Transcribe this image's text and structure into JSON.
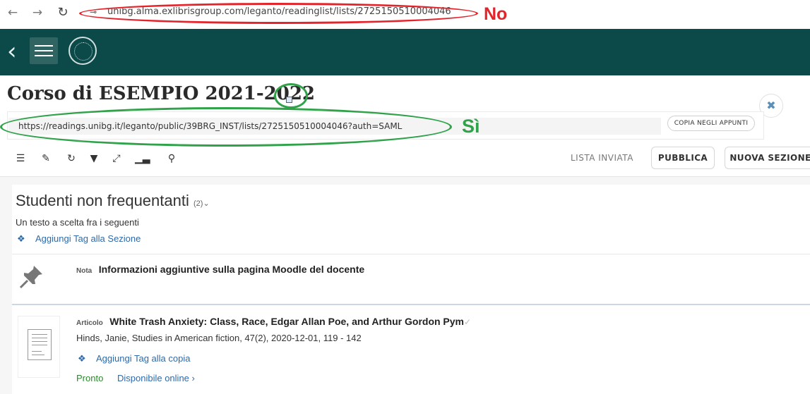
{
  "browser": {
    "url": "unibg.alma.exlibrisgroup.com/leganto/readinglist/lists/2725150510004046",
    "back_icon": "arrow-left-icon",
    "forward_icon": "arrow-right-icon",
    "reload_icon": "reload-icon"
  },
  "annotations": {
    "no_label": "No",
    "yes_label": "Sì",
    "red": "#e3242b",
    "green": "#2fa24a"
  },
  "header": {
    "bg_color": "#0b4a49",
    "back_icon": "chevron-left-icon",
    "menu_icon": "hamburger-icon",
    "logo_icon": "university-seal-icon"
  },
  "page": {
    "title": "Corso di ESEMPIO 2021-2022",
    "close_icon": "close-icon"
  },
  "share": {
    "link": "https://readings.unibg.it/leganto/public/39BRG_INST/lists/2725150510004046?auth=SAML",
    "copy_button": "COPIA NEGLI APPUNTI"
  },
  "toolbar": {
    "icons": [
      "list-icon",
      "edit-icon",
      "sync-icon",
      "filter-icon",
      "collapse-icon",
      "stats-icon",
      "search-icon"
    ],
    "status": "LISTA INVIATA",
    "publish_button": "PUBBLICA",
    "new_section_button": "NUOVA SEZIONE"
  },
  "section": {
    "title": "Studenti non frequentanti",
    "count": "(2)",
    "description": "Un testo a scelta fra i seguenti",
    "add_tag": "Aggiungi Tag alla Sezione"
  },
  "items": [
    {
      "type": "Nota",
      "title": "Informazioni aggiuntive sulla pagina Moodle del docente",
      "icon": "pin-icon"
    },
    {
      "type": "Articolo",
      "title": "White Trash Anxiety: Class, Race, Edgar Allan Poe, and Arthur Gordon Pym",
      "meta": "Hinds, Janie, Studies in American fiction, 47(2), 2020-12-01, 119 - 142",
      "add_tag": "Aggiungi Tag alla copia",
      "status": "Pronto",
      "availability": "Disponibile online",
      "icon": "document-thumbnail-icon"
    }
  ]
}
